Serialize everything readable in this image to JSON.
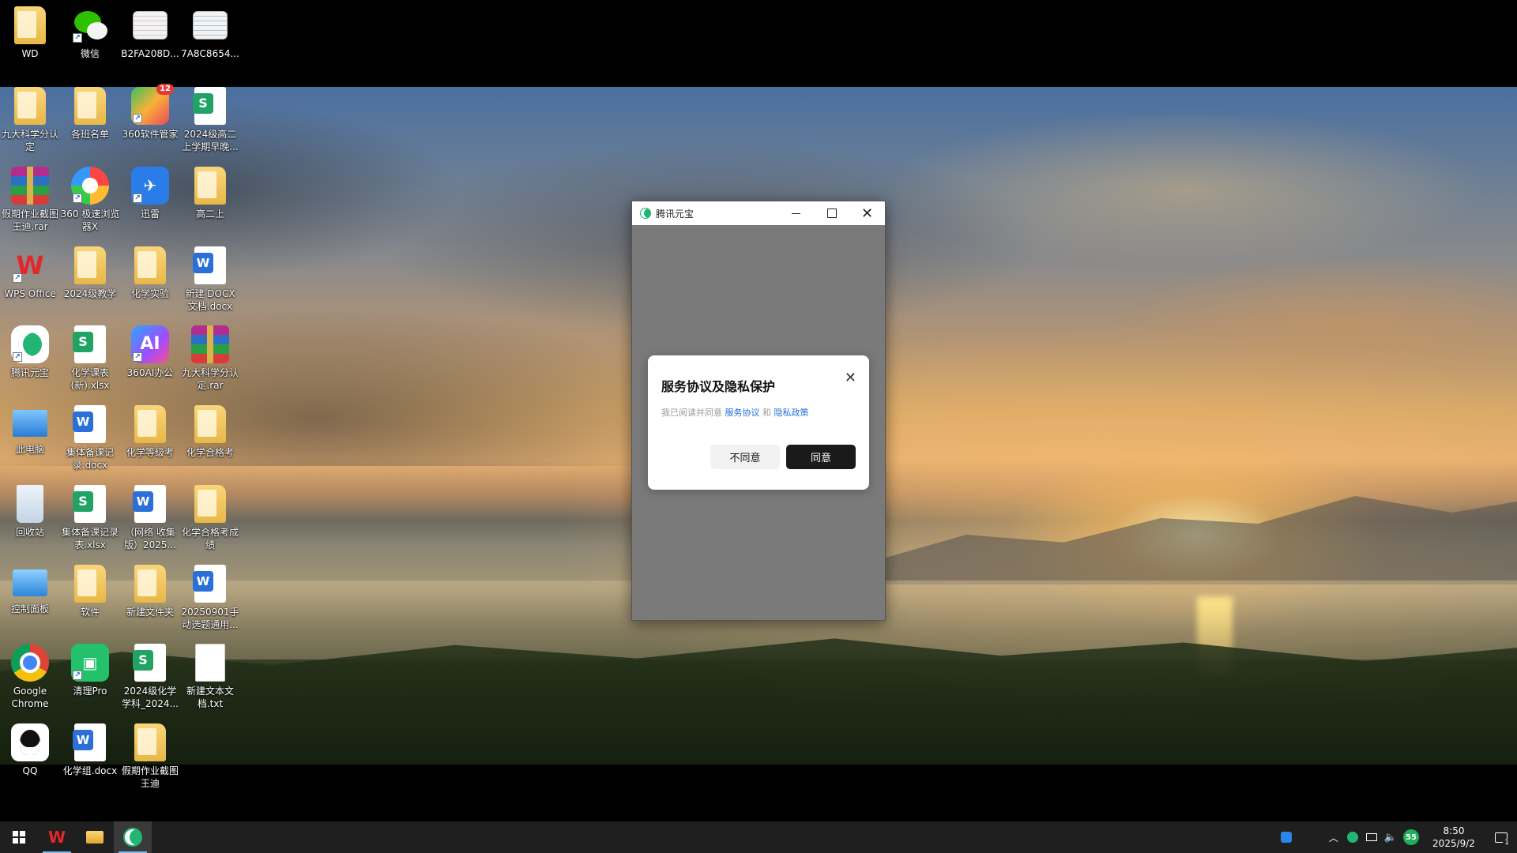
{
  "desktop": {
    "icons": [
      {
        "label": "WD",
        "icon": "user-folder-icon"
      },
      {
        "label": "微信",
        "icon": "wechat-icon"
      },
      {
        "label": "B2FA208D...",
        "icon": "image-file-icon"
      },
      {
        "label": "7A8C8654...",
        "icon": "image-file-icon"
      },
      {
        "label": "九大科学分认定",
        "icon": "folder-icon"
      },
      {
        "label": "各班名单",
        "icon": "folder-icon"
      },
      {
        "label": "360软件管家",
        "icon": "app-360-software-manager-icon",
        "badge": "12"
      },
      {
        "label": "2024级高二上学期早晚...",
        "icon": "spreadsheet-icon"
      },
      {
        "label": "假期作业截图王迪.rar",
        "icon": "rar-archive-icon"
      },
      {
        "label": "360 极速浏览器X",
        "icon": "browser-360-icon"
      },
      {
        "label": "迅雷",
        "icon": "xunlei-icon"
      },
      {
        "label": "高二上",
        "icon": "folder-icon"
      },
      {
        "label": "WPS Office",
        "icon": "wps-icon"
      },
      {
        "label": "2024级教学",
        "icon": "folder-icon"
      },
      {
        "label": "化学实验",
        "icon": "folder-icon"
      },
      {
        "label": "新建 DOCX 文档.docx",
        "icon": "word-document-icon"
      },
      {
        "label": "腾讯元宝",
        "icon": "yuanbao-icon"
      },
      {
        "label": "化学课表(新).xlsx",
        "icon": "spreadsheet-icon"
      },
      {
        "label": "360AI办公",
        "icon": "ai-360-icon"
      },
      {
        "label": "九大科学分认定.rar",
        "icon": "rar-archive-icon"
      },
      {
        "label": "此电脑",
        "icon": "this-pc-icon"
      },
      {
        "label": "集体备课记录.docx",
        "icon": "word-document-icon"
      },
      {
        "label": "化学等级考",
        "icon": "folder-icon"
      },
      {
        "label": "化学合格考",
        "icon": "folder-icon"
      },
      {
        "label": "回收站",
        "icon": "recycle-bin-icon"
      },
      {
        "label": "集体备课记录表.xlsx",
        "icon": "spreadsheet-icon"
      },
      {
        "label": "（网络 收集版）2025...",
        "icon": "word-document-icon"
      },
      {
        "label": "化学合格考成绩",
        "icon": "folder-icon"
      },
      {
        "label": "控制面板",
        "icon": "control-panel-icon"
      },
      {
        "label": "软件",
        "icon": "folder-icon"
      },
      {
        "label": "新建文件夹",
        "icon": "folder-icon"
      },
      {
        "label": "20250901手动选题通用...",
        "icon": "word-document-icon"
      },
      {
        "label": "Google Chrome",
        "icon": "chrome-icon"
      },
      {
        "label": "清理Pro",
        "icon": "cleaner-pro-icon"
      },
      {
        "label": "2024级化学学科_2024...",
        "icon": "spreadsheet-icon"
      },
      {
        "label": "新建文本文档.txt",
        "icon": "text-file-icon"
      },
      {
        "label": "QQ",
        "icon": "qq-icon"
      },
      {
        "label": "化学组.docx",
        "icon": "word-document-icon"
      },
      {
        "label": "假期作业截图王迪",
        "icon": "folder-icon"
      }
    ]
  },
  "app_window": {
    "title": "腾讯元宝",
    "logo_icon": "yuanbao-logo-icon"
  },
  "dialog": {
    "title": "服务协议及隐私保护",
    "text_prefix": "我已阅读并同意",
    "link_terms": "服务协议",
    "and": "和",
    "link_privacy": "隐私政策",
    "disagree_label": "不同意",
    "agree_label": "同意"
  },
  "taskbar": {
    "apps": [
      {
        "name": "WPS Office",
        "icon": "wps-icon"
      },
      {
        "name": "File Explorer",
        "icon": "file-explorer-icon"
      },
      {
        "name": "腾讯元宝",
        "icon": "yuanbao-icon",
        "active": true
      }
    ],
    "tray": {
      "badge_55": "55",
      "time": "8:50",
      "date": "2025/9/2",
      "notifications": "1"
    }
  },
  "colors": {
    "agree_button": "#1a1a1a",
    "link": "#1f6fd8",
    "taskbar": "#1f1f1f",
    "yuanbao_green": "#22b573"
  }
}
